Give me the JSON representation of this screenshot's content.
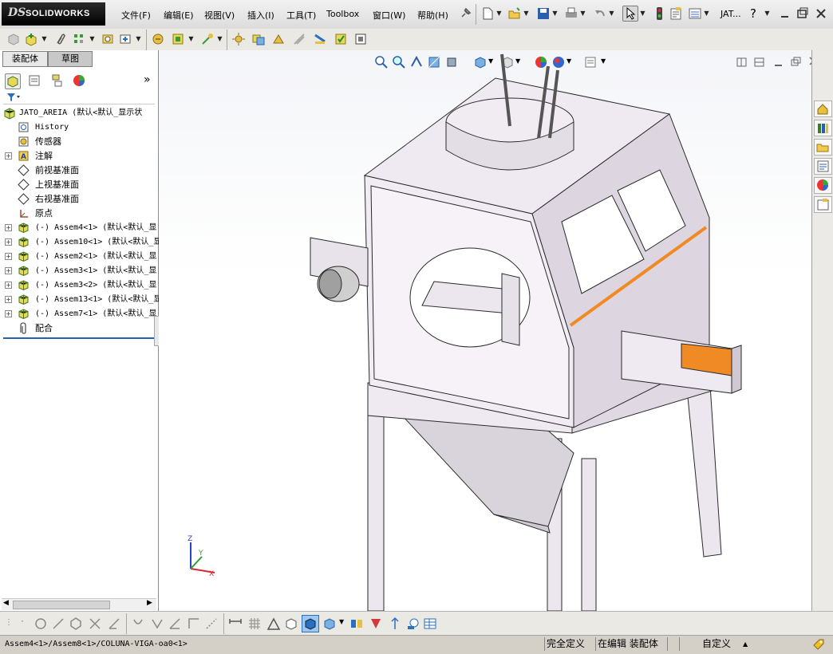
{
  "app": {
    "logo_ds": "DS",
    "logo_name": "SOLIDWORKS",
    "menu": [
      "文件(F)",
      "编辑(E)",
      "视图(V)",
      "插入(I)",
      "工具(T)",
      "Toolbox",
      "窗口(W)",
      "帮助(H)"
    ],
    "doc_short": "JAT...",
    "help_glyph": "?"
  },
  "feature_manager": {
    "tabs": [
      "装配体",
      "草图"
    ],
    "root": "JATO_AREIA  (默认<默认_显示状",
    "items": [
      {
        "label": "History",
        "icon": "history-icon",
        "mono": true,
        "expand": false
      },
      {
        "label": "传感器",
        "icon": "sensor-icon",
        "mono": false,
        "expand": false
      },
      {
        "label": "注解",
        "icon": "annotation-icon",
        "mono": false,
        "expand": true
      },
      {
        "label": "前视基准面",
        "icon": "plane-icon",
        "mono": false,
        "expand": false
      },
      {
        "label": "上视基准面",
        "icon": "plane-icon",
        "mono": false,
        "expand": false
      },
      {
        "label": "右视基准面",
        "icon": "plane-icon",
        "mono": false,
        "expand": false
      },
      {
        "label": "原点",
        "icon": "origin-icon",
        "mono": false,
        "expand": false
      },
      {
        "label": "(-) Assem4<1>  (默认<默认_显",
        "icon": "subassembly-icon",
        "mono": true,
        "expand": true
      },
      {
        "label": "(-) Assem10<1>  (默认<默认_显",
        "icon": "subassembly-icon",
        "mono": true,
        "expand": true
      },
      {
        "label": "(-) Assem2<1>  (默认<默认_显",
        "icon": "subassembly-icon",
        "mono": true,
        "expand": true
      },
      {
        "label": "(-) Assem3<1>  (默认<默认_显",
        "icon": "subassembly-icon",
        "mono": true,
        "expand": true
      },
      {
        "label": "(-) Assem3<2>  (默认<默认_显",
        "icon": "subassembly-icon",
        "mono": true,
        "expand": true
      },
      {
        "label": "(-) Assem13<1>  (默认<默认_显",
        "icon": "subassembly-icon",
        "mono": true,
        "expand": true
      },
      {
        "label": "(-) Assem7<1>  (默认<默认_显",
        "icon": "subassembly-icon",
        "mono": true,
        "expand": true
      },
      {
        "label": "配合",
        "icon": "mates-icon",
        "mono": false,
        "expand": false
      }
    ]
  },
  "triad": {
    "z": "Z",
    "y": "Y",
    "x": "X"
  },
  "statusbar": {
    "path": "Assem4<1>/Assem8<1>/COLUNA-VIGA-oa0<1>",
    "state": "完全定义",
    "mode": "在编辑 装配体",
    "custom": "自定义"
  },
  "colors": {
    "accent_orange": "#f08a24",
    "body_purple": "#e2dbe4",
    "title_black": "#000000"
  }
}
